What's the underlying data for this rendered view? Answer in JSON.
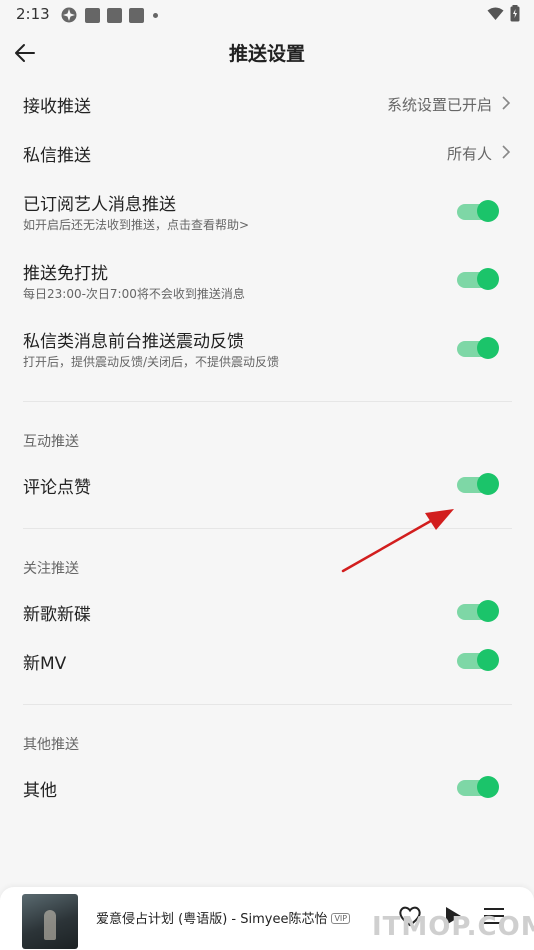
{
  "status_bar": {
    "time": "2:13"
  },
  "header": {
    "title": "推送设置"
  },
  "rows": [
    {
      "label": "接收推送",
      "value": "系统设置已开启"
    },
    {
      "label": "私信推送",
      "value": "所有人"
    },
    {
      "label": "已订阅艺人消息推送",
      "sub": "如开启后还无法收到推送，点击查看帮助>",
      "on": true
    },
    {
      "label": "推送免打扰",
      "sub": "每日23:00-次日7:00将不会收到推送消息",
      "on": true
    },
    {
      "label": "私信类消息前台推送震动反馈",
      "sub": "打开后，提供震动反馈/关闭后，不提供震动反馈",
      "on": true
    }
  ],
  "sections": [
    {
      "title": "互动推送",
      "items": [
        {
          "label": "评论点赞",
          "on": true
        }
      ]
    },
    {
      "title": "关注推送",
      "items": [
        {
          "label": "新歌新碟",
          "on": true
        },
        {
          "label": "新MV",
          "on": true
        }
      ]
    },
    {
      "title": "其他推送",
      "items": [
        {
          "label": "其他",
          "on": true
        }
      ]
    }
  ],
  "player": {
    "song": "爱意侵占计划 (粤语版) - Simyee陈芯怡",
    "badge": "VIP"
  },
  "watermark": "ITMOP.COM",
  "colors": {
    "toggle_track": "#7ed7a6",
    "toggle_knob": "#1bc46a",
    "annotation_arrow": "#d21e1e"
  }
}
